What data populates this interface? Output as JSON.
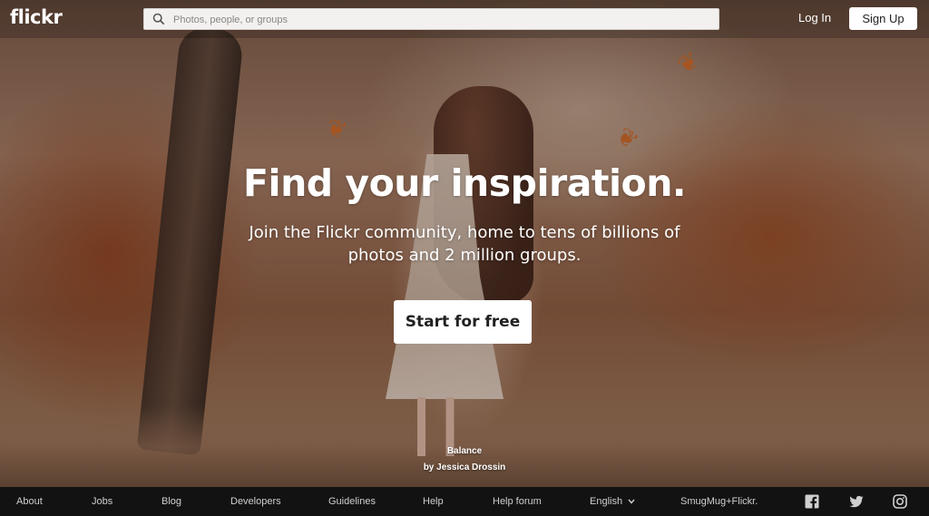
{
  "header": {
    "logo": "flickr",
    "search_placeholder": "Photos, people, or groups",
    "login_label": "Log In",
    "signup_label": "Sign Up"
  },
  "hero": {
    "title": "Find your inspiration.",
    "subtitle": "Join the Flickr community, home to tens of billions of photos and 2 million groups.",
    "cta_label": "Start for free"
  },
  "photo_credit": {
    "title": "Balance",
    "author": "by Jessica Drossin"
  },
  "footer": {
    "links": [
      "About",
      "Jobs",
      "Blog",
      "Developers",
      "Guidelines",
      "Help",
      "Help forum"
    ],
    "language": "English",
    "language_icon": "chevron-down-icon",
    "company": "SmugMug+Flickr.",
    "social_icons": [
      "facebook-icon",
      "twitter-icon",
      "instagram-icon"
    ]
  },
  "colors": {
    "footer_bg": "#121212",
    "button_bg": "#ffffff",
    "leaf": "#c8682a"
  }
}
